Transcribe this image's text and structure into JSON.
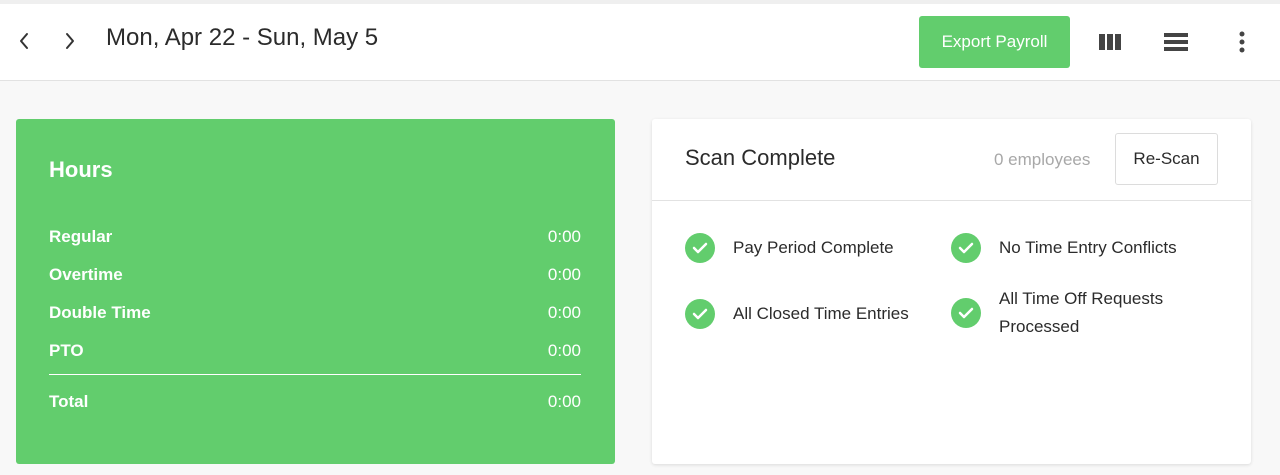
{
  "header": {
    "date_range": "Mon, Apr 22 - Sun, May 5",
    "export_label": "Export Payroll",
    "icons": {
      "prev": "chevron-left-icon",
      "next": "chevron-right-icon",
      "columns": "columns-view-icon",
      "rows": "list-view-icon",
      "more": "more-vertical-icon"
    }
  },
  "hours": {
    "title": "Hours",
    "rows": [
      {
        "label": "Regular",
        "value": "0:00"
      },
      {
        "label": "Overtime",
        "value": "0:00"
      },
      {
        "label": "Double Time",
        "value": "0:00"
      },
      {
        "label": "PTO",
        "value": "0:00"
      }
    ],
    "total": {
      "label": "Total",
      "value": "0:00"
    }
  },
  "scan": {
    "title": "Scan Complete",
    "count": "0 employees",
    "rescan_label": "Re-Scan",
    "checks": [
      {
        "label": "Pay Period Complete"
      },
      {
        "label": "No Time Entry Conflicts"
      },
      {
        "label": "All Closed Time Entries"
      },
      {
        "label": "All Time Off Requests Processed"
      }
    ]
  },
  "colors": {
    "accent": "#62cd6d",
    "text": "#2b2b2b",
    "muted": "#a8a8a8",
    "background": "#f8f8f8"
  }
}
